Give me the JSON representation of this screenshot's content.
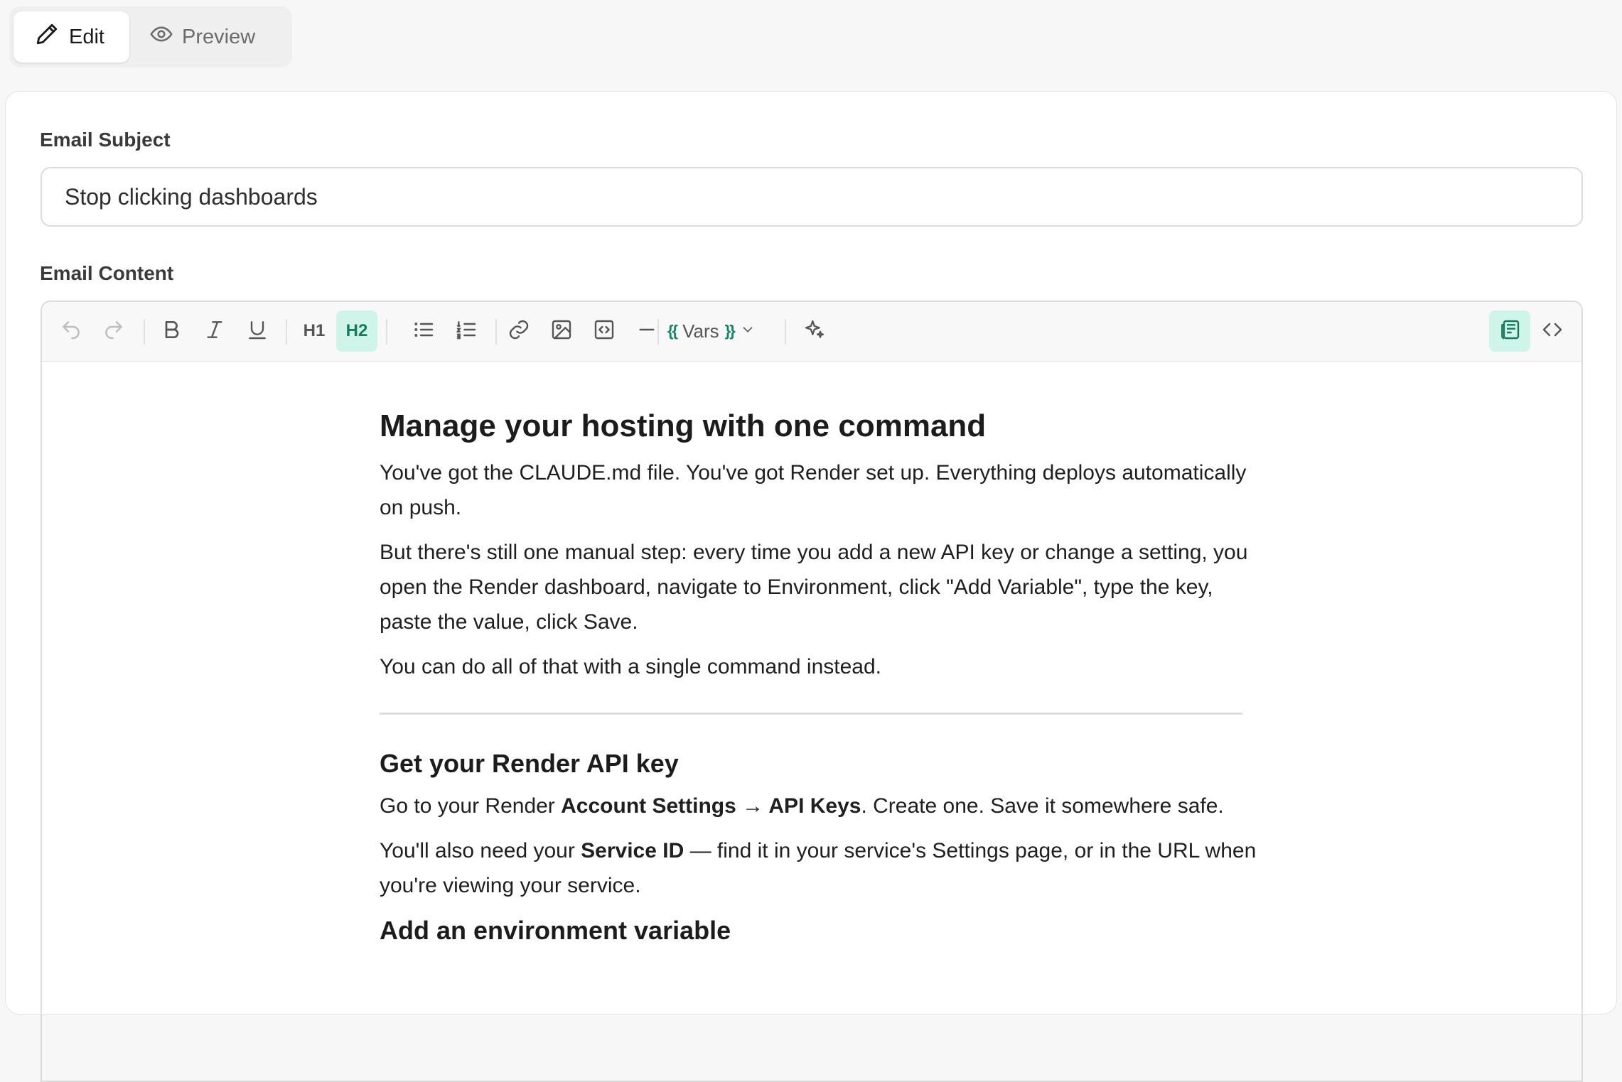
{
  "tabs": {
    "edit_label": "Edit",
    "preview_label": "Preview"
  },
  "subject": {
    "label": "Email Subject",
    "value": "Stop clicking dashboards"
  },
  "content_field": {
    "label": "Email Content"
  },
  "toolbar": {
    "h1_label": "H1",
    "h2_label": "H2",
    "vars_open": "{{",
    "vars_label": "Vars",
    "vars_close": "}}",
    "active_items": [
      "h2",
      "layout-toggle"
    ],
    "accent_color": "#157a5e",
    "accent_bg": "#cff5ea",
    "icons": [
      "undo-icon",
      "redo-icon",
      "bold-icon",
      "italic-icon",
      "underline-icon",
      "bullet-list-icon",
      "ordered-list-icon",
      "link-icon",
      "image-icon",
      "embed-icon",
      "horizontal-rule-icon",
      "ai-sparkle-icon",
      "document-layout-icon",
      "code-view-icon"
    ]
  },
  "doc": {
    "heading1": "Manage your hosting with one command",
    "p1": "You've got the CLAUDE.md file. You've got Render set up. Everything deploys automatically on push.",
    "p2": "But there's still one manual step: every time you add a new API key or change a setting, you open the Render dashboard, navigate to Environment, click \"Add Variable\", type the key, paste the value, click Save.",
    "p3": "You can do all of that with a single command instead.",
    "heading2_a": "Get your Render API key",
    "p4_pre": "Go to your Render ",
    "p4_bold1": "Account Settings",
    "p4_arrow": " → ",
    "p4_bold2": "API Keys",
    "p4_post": ". Create one. Save it somewhere safe.",
    "p5_pre": "You'll also need your ",
    "p5_bold": "Service ID",
    "p5_post": " — find it in your service's Settings page, or in the URL when you're viewing your service.",
    "heading2_b": "Add an environment variable"
  }
}
